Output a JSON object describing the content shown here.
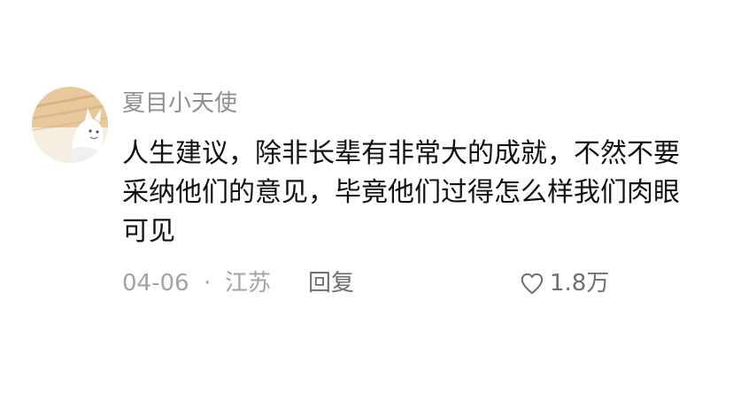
{
  "comment": {
    "username": "夏目小天使",
    "content": "人生建议，除非长辈有非常大的成就，不然不要采纳他们的意见，毕竟他们过得怎么样我们肉眼可见",
    "date": "04-06",
    "separator": "·",
    "location": "江苏",
    "reply_label": "回复",
    "like_count": "1.8万",
    "like_icon": "heart-outline-icon",
    "avatar_icon": "cat-avatar-icon"
  },
  "colors": {
    "username": "#8f8f8f",
    "content": "#111111",
    "meta": "#a3a3a3",
    "action": "#6f6f6f",
    "background": "#ffffff"
  }
}
